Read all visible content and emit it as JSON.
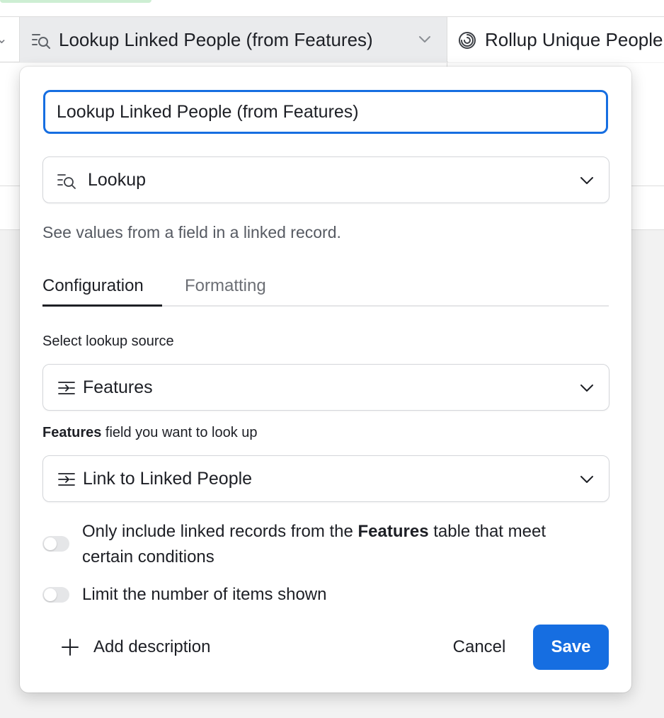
{
  "grid": {
    "active_column": {
      "label": "Lookup Linked People (from Features)",
      "icon": "lookup-icon"
    },
    "next_column": {
      "label": "Rollup Unique People",
      "icon": "rollup-spiral-icon"
    }
  },
  "dialog": {
    "field_name_value": "Lookup Linked People (from Features)",
    "field_type": {
      "label": "Lookup",
      "icon": "lookup-icon"
    },
    "type_description": "See values from a field in a linked record.",
    "tabs": [
      {
        "label": "Configuration",
        "active": true
      },
      {
        "label": "Formatting",
        "active": false
      }
    ],
    "lookup_source": {
      "label": "Select lookup source",
      "value": "Features",
      "icon": "link-field-icon"
    },
    "lookup_field": {
      "label_bold": "Features",
      "label_rest": " field you want to look up",
      "value": "Link to Linked People",
      "icon": "link-field-icon"
    },
    "conditions_toggle": {
      "text_before": "Only include linked records from the ",
      "text_bold": "Features",
      "text_after": " table that meet certain conditions",
      "on": false
    },
    "limit_toggle": {
      "text": "Limit the number of items shown",
      "on": false
    },
    "add_description_label": "Add description",
    "cancel_label": "Cancel",
    "save_label": "Save"
  },
  "colors": {
    "accent": "#166ee1",
    "header_active_bg": "#eaebed",
    "toggle_off": "#e5e6e8"
  }
}
